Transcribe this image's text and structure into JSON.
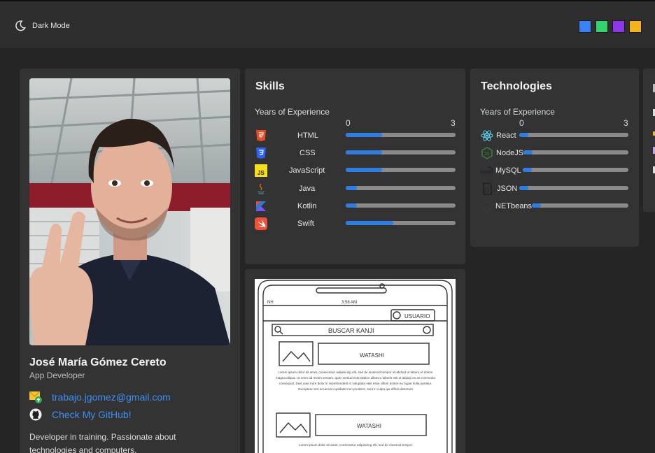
{
  "header": {
    "dark_mode_label": "Dark Mode",
    "theme_swatches": [
      {
        "name": "blue",
        "color": "#3b82f6"
      },
      {
        "name": "green",
        "color": "#34d36f"
      },
      {
        "name": "purple",
        "color": "#8e37e6"
      },
      {
        "name": "yellow",
        "color": "#f3b31f"
      }
    ]
  },
  "profile": {
    "name": "José María Gómez Cereto",
    "role": "App Developer",
    "email": "trabajo.jgomez@gmail.com",
    "github_label": "Check My GitHub!",
    "bio": "Developer in training. Passionate about technologies and computers."
  },
  "skills": {
    "title": "Skills",
    "subtitle": "Years of Experience",
    "scale_min": "0",
    "scale_max": "3",
    "items": [
      {
        "label": "HTML",
        "icon": "html5-icon",
        "years": 1.0
      },
      {
        "label": "CSS",
        "icon": "css3-icon",
        "years": 1.0
      },
      {
        "label": "JavaScript",
        "icon": "javascript-icon",
        "years": 1.0
      },
      {
        "label": "Java",
        "icon": "java-icon",
        "years": 0.3
      },
      {
        "label": "Kotlin",
        "icon": "kotlin-icon",
        "years": 0.3
      },
      {
        "label": "Swift",
        "icon": "swift-icon",
        "years": 1.3
      }
    ]
  },
  "technologies": {
    "title": "Technologies",
    "subtitle": "Years of Experience",
    "scale_min": "0",
    "scale_max": "3",
    "items": [
      {
        "label": "React",
        "icon": "react-icon",
        "years": 0.25
      },
      {
        "label": "NodeJS",
        "icon": "nodejs-icon",
        "years": 0.25
      },
      {
        "label": "MySQL",
        "icon": "mysql-icon",
        "years": 0.25
      },
      {
        "label": "JSON",
        "icon": "json-icon",
        "years": 0.25
      },
      {
        "label": "NETbeans",
        "icon": "netbeans-icon",
        "years": 0.25
      }
    ]
  },
  "sketch": {
    "status_time": "3:58 AM",
    "status_left": "NH",
    "user_button": "USUARIO",
    "search_label": "BUSCAR KANJI",
    "card_label": "WATASHI",
    "lorem": "Lorem ipsum dolor sit amet, consectetur adipisicing elit, sed do eiusmod tempor incididunt ut labore et dolore magna aliqua. Ut enim ad minim veniam, quis nostrud exercitation ullamco laboris nisi ut aliquip ex ea commodo consequat. Duis aute irure dolor in reprehenderit in voluptate velit esse cillum dolore eu fugiat nulla pariatur. Excepteur sint occaecat cupidatat non proident, sunt in culpa qui officia deserunt",
    "lorem_short": "Lorem ipsum dolor sit amet, consectetur adipisicing elit, sed do eiusmod tempor"
  }
}
